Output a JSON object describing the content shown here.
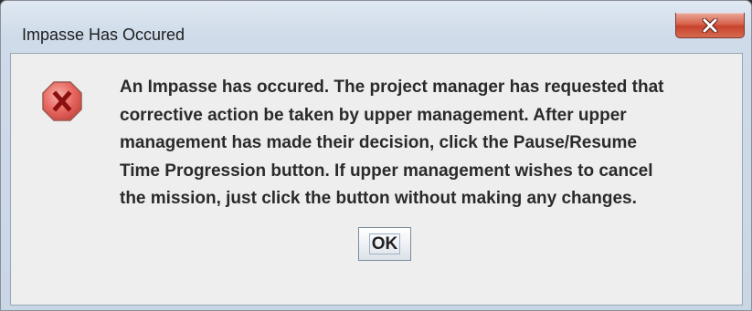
{
  "window": {
    "title": "Impasse Has Occured"
  },
  "title_bar": {
    "close_icon": "close-x-icon"
  },
  "dialog": {
    "icon": "error-icon",
    "message_lines": [
      "An Impasse has occured. The project manager has requested that",
      "corrective action be taken by upper management. After upper",
      "management has made their decision, click the Pause/Resume",
      "Time Progression button. If upper management wishes to cancel",
      "the mission, just click the button without making any changes."
    ],
    "ok_label": "OK"
  },
  "colors": {
    "title_bar": "#cfdbe9",
    "close_button": "#c7432c",
    "dialog_background": "#eeeeee",
    "error_icon_fill": "#e86a63",
    "error_glyph": "#8a0f0f",
    "message_text": "#2a2a2a"
  }
}
